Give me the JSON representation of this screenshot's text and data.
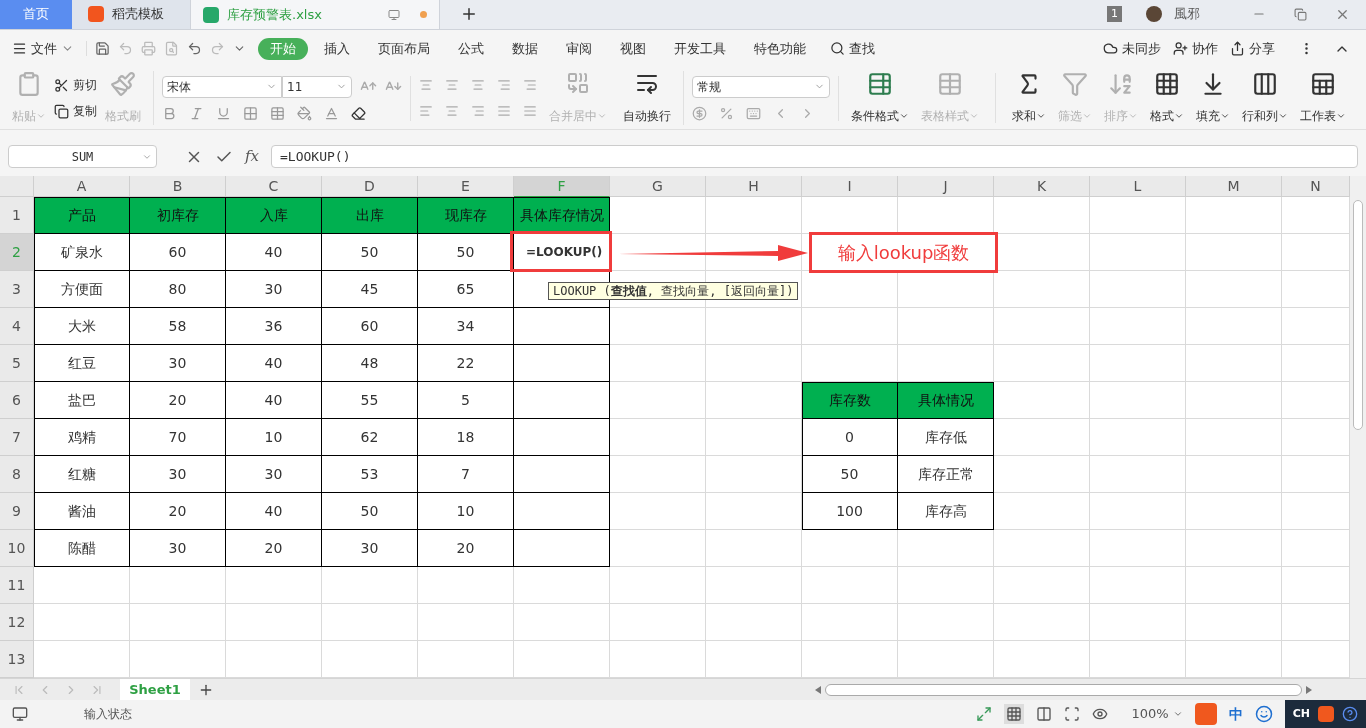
{
  "title_bar": {
    "tabs": [
      {
        "label": "首页",
        "kind": "home",
        "selected": false
      },
      {
        "label": "稻壳模板",
        "kind": "docer",
        "selected": false
      },
      {
        "label": "库存预警表.xlsx",
        "kind": "sheet",
        "selected": true
      }
    ],
    "badge": "1",
    "user": "風邪"
  },
  "menu": {
    "file": "文件",
    "tabs": [
      {
        "label": "开始",
        "selected": true
      },
      {
        "label": "插入",
        "selected": false
      },
      {
        "label": "页面布局",
        "selected": false
      },
      {
        "label": "公式",
        "selected": false
      },
      {
        "label": "数据",
        "selected": false
      },
      {
        "label": "审阅",
        "selected": false
      },
      {
        "label": "视图",
        "selected": false
      },
      {
        "label": "开发工具",
        "selected": false
      },
      {
        "label": "特色功能",
        "selected": false
      }
    ],
    "search": "查找",
    "actions": [
      "未同步",
      "协作",
      "分享"
    ]
  },
  "ribbon": {
    "clipboard": [
      {
        "label": "粘贴",
        "disabled": true
      },
      {
        "label": "剪切",
        "disabled": false
      },
      {
        "label": "复制",
        "disabled": false
      },
      {
        "label": "格式刷",
        "disabled": true
      }
    ],
    "font_name": "宋体",
    "font_size": "11",
    "alignment": [
      {
        "label": "合并居中",
        "disabled": true
      },
      {
        "label": "自动换行",
        "disabled": false
      }
    ],
    "number_format": "常规",
    "tools": [
      {
        "label": "条件格式",
        "disabled": false
      },
      {
        "label": "表格样式",
        "disabled": true
      },
      {
        "label": "求和",
        "disabled": false
      },
      {
        "label": "筛选",
        "disabled": true
      },
      {
        "label": "排序",
        "disabled": true
      },
      {
        "label": "格式",
        "disabled": false
      },
      {
        "label": "填充",
        "disabled": false
      },
      {
        "label": "行和列",
        "disabled": false
      },
      {
        "label": "工作表",
        "disabled": false
      }
    ]
  },
  "formula_bar": {
    "name_box": "SUM",
    "function_label": "fx",
    "formula": "=LOOKUP()"
  },
  "sheet": {
    "columns": [
      {
        "label": "A",
        "selected": false
      },
      {
        "label": "B",
        "selected": false
      },
      {
        "label": "C",
        "selected": false
      },
      {
        "label": "D",
        "selected": false
      },
      {
        "label": "E",
        "selected": false
      },
      {
        "label": "F",
        "selected": true
      },
      {
        "label": "G",
        "selected": false
      },
      {
        "label": "H",
        "selected": false
      },
      {
        "label": "I",
        "selected": false
      },
      {
        "label": "J",
        "selected": false
      },
      {
        "label": "K",
        "selected": false
      },
      {
        "label": "L",
        "selected": false
      },
      {
        "label": "M",
        "selected": false
      },
      {
        "label": "N",
        "selected": false
      }
    ],
    "rows": [
      {
        "label": "1",
        "selected": false,
        "cells": [
          {
            "text": "产品",
            "kind": "header"
          },
          {
            "text": "初库存",
            "kind": "header"
          },
          {
            "text": "入库",
            "kind": "header"
          },
          {
            "text": "出库",
            "kind": "header"
          },
          {
            "text": "现库存",
            "kind": "header"
          },
          {
            "text": "具体库存情况",
            "kind": "header"
          }
        ]
      },
      {
        "label": "2",
        "selected": true,
        "cells": [
          {
            "text": "矿泉水",
            "kind": "data"
          },
          {
            "text": "60",
            "kind": "data"
          },
          {
            "text": "40",
            "kind": "data"
          },
          {
            "text": "50",
            "kind": "data"
          },
          {
            "text": "50",
            "kind": "data"
          },
          {
            "text": "=LOOKUP()",
            "kind": "editing"
          }
        ]
      },
      {
        "label": "3",
        "selected": false,
        "cells": [
          {
            "text": "方便面",
            "kind": "data"
          },
          {
            "text": "80",
            "kind": "data"
          },
          {
            "text": "30",
            "kind": "data"
          },
          {
            "text": "45",
            "kind": "data"
          },
          {
            "text": "65",
            "kind": "data"
          },
          {
            "kind": "data"
          }
        ]
      },
      {
        "label": "4",
        "selected": false,
        "cells": [
          {
            "text": "大米",
            "kind": "data"
          },
          {
            "text": "58",
            "kind": "data"
          },
          {
            "text": "36",
            "kind": "data"
          },
          {
            "text": "60",
            "kind": "data"
          },
          {
            "text": "34",
            "kind": "data"
          },
          {
            "kind": "data"
          }
        ]
      },
      {
        "label": "5",
        "selected": false,
        "cells": [
          {
            "text": "红豆",
            "kind": "data"
          },
          {
            "text": "30",
            "kind": "data"
          },
          {
            "text": "40",
            "kind": "data"
          },
          {
            "text": "48",
            "kind": "data"
          },
          {
            "text": "22",
            "kind": "data"
          },
          {
            "kind": "data"
          }
        ]
      },
      {
        "label": "6",
        "selected": false,
        "cells": [
          {
            "text": "盐巴",
            "kind": "data"
          },
          {
            "text": "20",
            "kind": "data"
          },
          {
            "text": "40",
            "kind": "data"
          },
          {
            "text": "55",
            "kind": "data"
          },
          {
            "text": "5",
            "kind": "data"
          },
          {
            "kind": "data"
          },
          {
            "kind": "plain"
          },
          {
            "kind": "plain"
          },
          {
            "text": "库存数",
            "kind": "header"
          },
          {
            "text": "具体情况",
            "kind": "header"
          }
        ]
      },
      {
        "label": "7",
        "selected": false,
        "cells": [
          {
            "text": "鸡精",
            "kind": "data"
          },
          {
            "text": "70",
            "kind": "data"
          },
          {
            "text": "10",
            "kind": "data"
          },
          {
            "text": "62",
            "kind": "data"
          },
          {
            "text": "18",
            "kind": "data"
          },
          {
            "kind": "data"
          },
          {
            "kind": "plain"
          },
          {
            "kind": "plain"
          },
          {
            "text": "0",
            "kind": "data"
          },
          {
            "text": "库存低",
            "kind": "data"
          }
        ]
      },
      {
        "label": "8",
        "selected": false,
        "cells": [
          {
            "text": "红糖",
            "kind": "data"
          },
          {
            "text": "30",
            "kind": "data"
          },
          {
            "text": "30",
            "kind": "data"
          },
          {
            "text": "53",
            "kind": "data"
          },
          {
            "text": "7",
            "kind": "data"
          },
          {
            "kind": "data"
          },
          {
            "kind": "plain"
          },
          {
            "kind": "plain"
          },
          {
            "text": "50",
            "kind": "data"
          },
          {
            "text": "库存正常",
            "kind": "data"
          }
        ]
      },
      {
        "label": "9",
        "selected": false,
        "cells": [
          {
            "text": "酱油",
            "kind": "data"
          },
          {
            "text": "20",
            "kind": "data"
          },
          {
            "text": "40",
            "kind": "data"
          },
          {
            "text": "50",
            "kind": "data"
          },
          {
            "text": "10",
            "kind": "data"
          },
          {
            "kind": "data"
          },
          {
            "kind": "plain"
          },
          {
            "kind": "plain"
          },
          {
            "text": "100",
            "kind": "data"
          },
          {
            "text": "库存高",
            "kind": "data"
          }
        ]
      },
      {
        "label": "10",
        "selected": false,
        "cells": [
          {
            "text": "陈醋",
            "kind": "data"
          },
          {
            "text": "30",
            "kind": "data"
          },
          {
            "text": "20",
            "kind": "data"
          },
          {
            "text": "30",
            "kind": "data"
          },
          {
            "text": "20",
            "kind": "data"
          },
          {
            "kind": "data"
          }
        ]
      },
      {
        "label": "11",
        "selected": false
      },
      {
        "label": "12",
        "selected": false
      },
      {
        "label": "13",
        "selected": false
      }
    ],
    "tooltip": "LOOKUP (**查找值**, 查找向量, [返回向量])",
    "callout": "输入lookup函数"
  },
  "sheet_tabs": [
    {
      "label": "Sheet1",
      "selected": true
    }
  ],
  "status_bar": {
    "mode": "输入状态",
    "zoom": "100%",
    "ime": [
      "中",
      "CH"
    ]
  }
}
